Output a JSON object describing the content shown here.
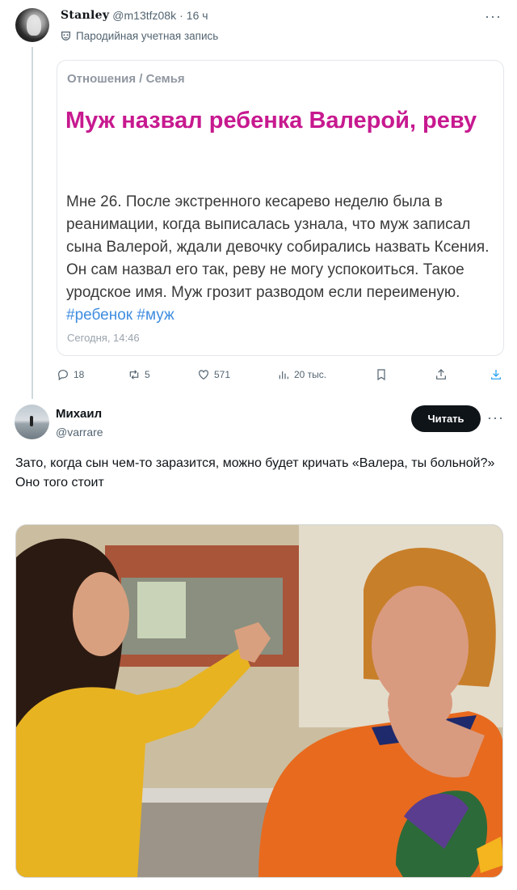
{
  "tweet1": {
    "display_name": "Stanley",
    "handle": "@m13tfz08k",
    "separator": "·",
    "time": "16 ч",
    "parody_label": "Пародийная учетная запись",
    "more": "···",
    "card": {
      "breadcrumb": "Отношения / Семья",
      "title": "Муж назвал ребенка Валерой, реву",
      "body": "Мне 26. После экстренного кесарево неделю была в реанимации, когда выписалась узнала, что муж записал сына Валерой, ждали девочку собирались назвать Ксения. Он сам назвал его так, реву не могу успокоиться. Такое уродское имя. Муж грозит разводом если переименую.",
      "tag1": "#ребенок",
      "tag2": "#муж",
      "date": "Сегодня, 14:46"
    },
    "actions": {
      "replies": "18",
      "reposts": "5",
      "likes": "571",
      "views": "20 тыс."
    }
  },
  "tweet2": {
    "display_name": "Михаил",
    "handle": "@varrare",
    "follow_label": "Читать",
    "more": "···",
    "text_line1": "Зато, когда сын чем-то заразится, можно будет кричать «Валера, ты больной?»",
    "text_line2": "Оно того стоит"
  },
  "icons": {
    "parody": "mask-icon",
    "reply": "reply-icon",
    "repost": "repost-icon",
    "like": "heart-icon",
    "views": "views-icon",
    "bookmark": "bookmark-icon",
    "share": "share-icon",
    "download": "download-icon"
  },
  "colors": {
    "article_title": "#c7198f",
    "hashtag": "#3f8de0",
    "muted": "#536471",
    "download_accent": "#1d9bf0"
  }
}
